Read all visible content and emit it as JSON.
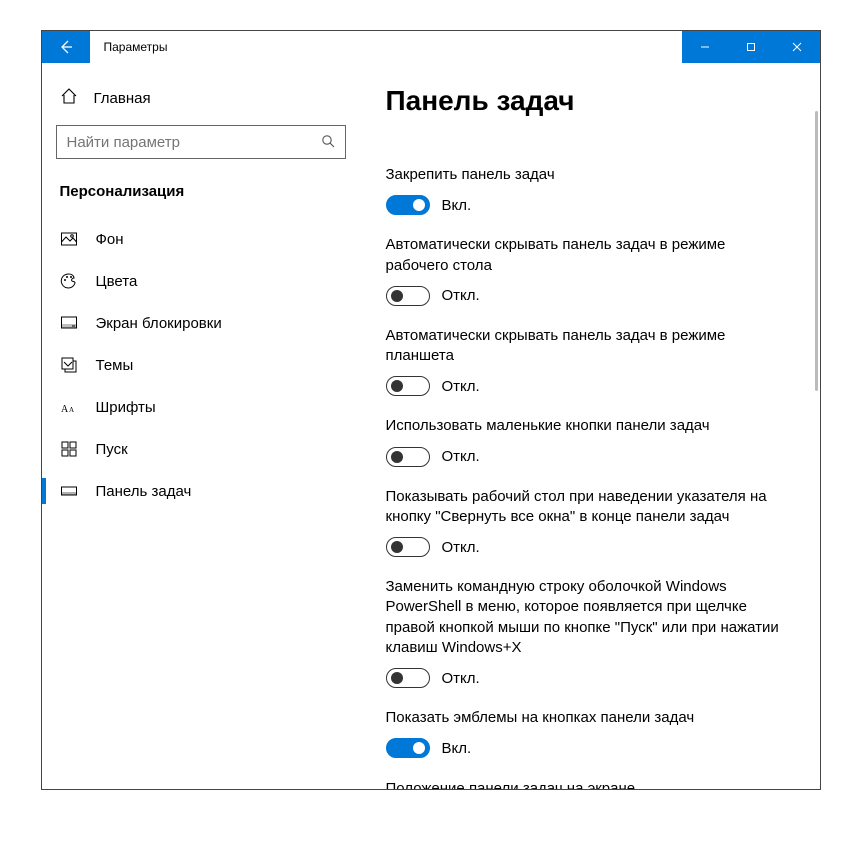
{
  "window": {
    "title": "Параметры"
  },
  "sidebar": {
    "home": "Главная",
    "search_placeholder": "Найти параметр",
    "category": "Персонализация",
    "items": [
      {
        "id": "background",
        "label": "Фон"
      },
      {
        "id": "colors",
        "label": "Цвета"
      },
      {
        "id": "lockscreen",
        "label": "Экран блокировки"
      },
      {
        "id": "themes",
        "label": "Темы"
      },
      {
        "id": "fonts",
        "label": "Шрифты"
      },
      {
        "id": "start",
        "label": "Пуск"
      },
      {
        "id": "taskbar",
        "label": "Панель задач"
      }
    ]
  },
  "page": {
    "title": "Панель задач",
    "on_label": "Вкл.",
    "off_label": "Откл.",
    "settings": [
      {
        "label": "Закрепить панель задач",
        "on": true
      },
      {
        "label": "Автоматически скрывать панель задач в режиме рабочего стола",
        "on": false
      },
      {
        "label": "Автоматически скрывать панель задач в режиме планшета",
        "on": false
      },
      {
        "label": "Использовать маленькие кнопки панели задач",
        "on": false
      },
      {
        "label": "Показывать рабочий стол при наведении указателя на кнопку \"Свернуть все окна\" в конце панели задач",
        "on": false
      },
      {
        "label": "Заменить командную строку оболочкой Windows PowerShell в меню, которое появляется при щелчке правой кнопкой мыши по кнопке \"Пуск\" или при нажатии клавиш Windows+X",
        "on": false
      },
      {
        "label": "Показать эмблемы на кнопках панели задач",
        "on": true
      }
    ],
    "next_heading": "Положение панели задач на экране"
  }
}
